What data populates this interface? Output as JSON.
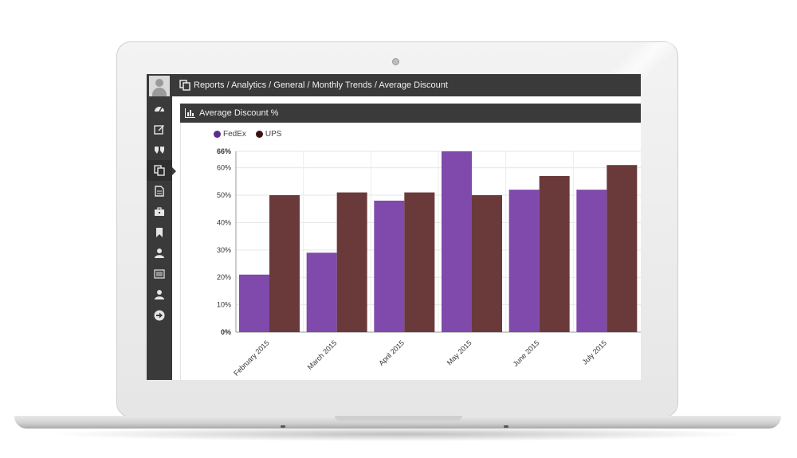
{
  "breadcrumb": "Reports / Analytics / General / Monthly Trends / Average Discount",
  "panel_title": "Average Discount %",
  "sidebar": {
    "items": [
      {
        "icon": "dashboard-icon"
      },
      {
        "icon": "edit-icon"
      },
      {
        "icon": "quote-icon"
      },
      {
        "icon": "copy-icon",
        "active": true
      },
      {
        "icon": "document-icon"
      },
      {
        "icon": "briefcase-icon"
      },
      {
        "icon": "bookmark-icon"
      },
      {
        "icon": "user-icon"
      },
      {
        "icon": "list-icon"
      },
      {
        "icon": "user-icon"
      },
      {
        "icon": "arrow-right-icon"
      }
    ]
  },
  "colors": {
    "fedex": "#7f4aab",
    "ups": "#6a3a3a",
    "dark": "#3a3a3a"
  },
  "chart_data": {
    "type": "bar",
    "categories": [
      "February 2015",
      "March 2015",
      "April 2015",
      "May 2015",
      "June 2015",
      "July 2015"
    ],
    "series": [
      {
        "name": "FedEx",
        "values": [
          21,
          29,
          48,
          66,
          52,
          52
        ]
      },
      {
        "name": "UPS",
        "values": [
          50,
          51,
          51,
          50,
          57,
          61
        ]
      }
    ],
    "yticks": [
      "0%",
      "10%",
      "20%",
      "30%",
      "40%",
      "50%",
      "60%",
      "66%"
    ],
    "ylim": [
      0,
      66
    ],
    "grid": true,
    "legend": "top-left"
  }
}
